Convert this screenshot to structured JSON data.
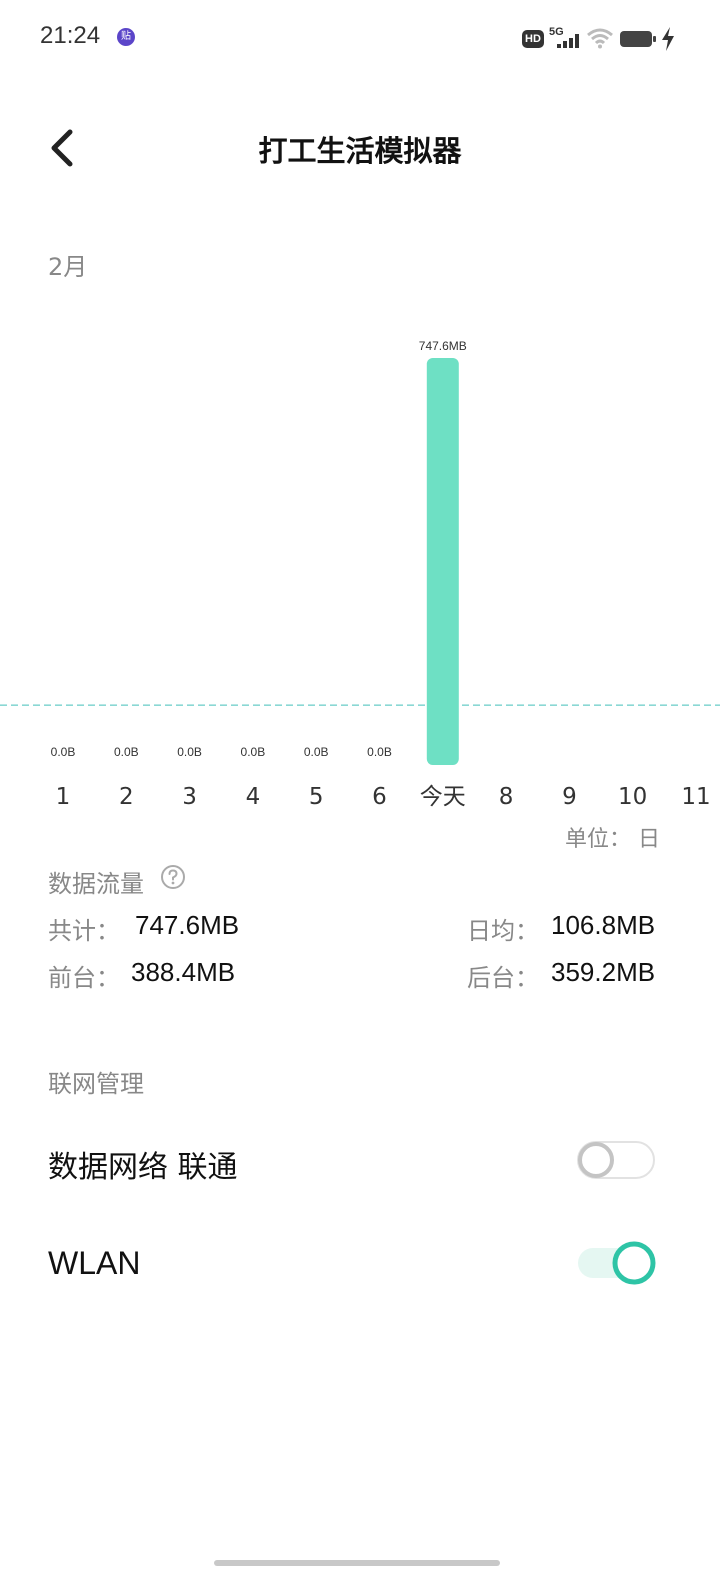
{
  "status_bar": {
    "time": "21:24",
    "app_badge": "贴",
    "hd_badge": "HD",
    "network": "5G",
    "icons": [
      "signal-icon",
      "wifi-icon",
      "battery-icon",
      "charging-icon"
    ]
  },
  "header": {
    "title": "打工生活模拟器",
    "back_icon": "chevron-left-icon"
  },
  "chart_section": {
    "month": "2月",
    "unit": "单位：  日"
  },
  "chart_data": {
    "type": "bar",
    "categories": [
      "1",
      "2",
      "3",
      "4",
      "5",
      "6",
      "今天",
      "8",
      "9",
      "10",
      "11"
    ],
    "values": [
      0,
      0,
      0,
      0,
      0,
      0,
      747.6,
      null,
      null,
      null,
      null
    ],
    "value_labels": [
      "0.0B",
      "0.0B",
      "0.0B",
      "0.0B",
      "0.0B",
      "0.0B",
      "747.6MB",
      "",
      "",
      "",
      ""
    ],
    "unit": "MB",
    "average": 106.8,
    "bar_color": "#6ee0c4",
    "average_line_color": "#8ad8d4"
  },
  "data_usage": {
    "title": "数据流量",
    "help_icon": "question-circle-icon",
    "total_label": "共计：",
    "total_value": "747.6MB",
    "daily_avg_label": "日均：",
    "daily_avg_value": "106.8MB",
    "foreground_label": "前台：",
    "foreground_value": "388.4MB",
    "background_label": "后台：",
    "background_value": "359.2MB"
  },
  "network_mgmt": {
    "title": "联网管理",
    "mobile_data_label": "数据网络 联通",
    "mobile_data_enabled": false,
    "wlan_label": "WLAN",
    "wlan_enabled": true,
    "accent": "#2ec4a6"
  }
}
